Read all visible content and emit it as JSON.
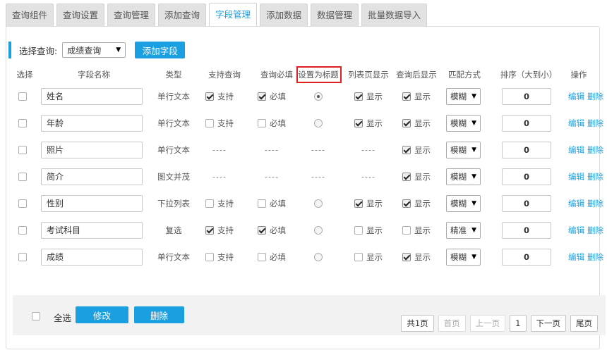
{
  "tabs": [
    "查询组件",
    "查询设置",
    "查询管理",
    "添加查询",
    "字段管理",
    "添加数据",
    "数据管理",
    "批量数据导入"
  ],
  "active_tab": 4,
  "toolbar": {
    "select_label": "选择查询:",
    "selected_query": "成绩查询",
    "add_field_label": "添加字段"
  },
  "columns": [
    "选择",
    "字段名称",
    "类型",
    "支持查询",
    "查询必填",
    "设置为标题",
    "列表页显示",
    "查询后显示",
    "匹配方式",
    "排序（大到小）",
    "操作"
  ],
  "highlighted_column": "设置为标题",
  "labels": {
    "support": "支持",
    "required": "必填",
    "show": "显示",
    "edit": "编辑",
    "delete": "删除",
    "dash": "----"
  },
  "rows": [
    {
      "name": "姓名",
      "type": "单行文本",
      "support": true,
      "required": true,
      "title": true,
      "list": true,
      "after": true,
      "match": "模糊",
      "order": "0"
    },
    {
      "name": "年龄",
      "type": "单行文本",
      "support": false,
      "required": false,
      "title": false,
      "list": true,
      "after": true,
      "match": "模糊",
      "order": "0"
    },
    {
      "name": "照片",
      "type": "单行文本",
      "support": null,
      "required": null,
      "title": null,
      "list": null,
      "after": true,
      "match": "模糊",
      "order": "0"
    },
    {
      "name": "简介",
      "type": "图文并茂",
      "support": null,
      "required": null,
      "title": null,
      "list": null,
      "after": true,
      "match": "模糊",
      "order": "0"
    },
    {
      "name": "性别",
      "type": "下拉列表",
      "support": false,
      "required": false,
      "title": false,
      "list": true,
      "after": true,
      "match": "模糊",
      "order": "0"
    },
    {
      "name": "考试科目",
      "type": "复选",
      "support": true,
      "required": true,
      "title": false,
      "list": false,
      "after": false,
      "match": "精准",
      "order": "0"
    },
    {
      "name": "成绩",
      "type": "单行文本",
      "support": false,
      "required": false,
      "title": false,
      "list": false,
      "after": true,
      "match": "模糊",
      "order": "0"
    }
  ],
  "footer": {
    "select_all_label": "全选",
    "modify_label": "修改",
    "delete_label": "删除"
  },
  "pager": {
    "total": "共1页",
    "first": "首页",
    "prev": "上一页",
    "current": "1",
    "next": "下一页",
    "last": "尾页"
  },
  "colors": {
    "accent": "#1a9fe0",
    "highlight_border": "#e02020"
  }
}
